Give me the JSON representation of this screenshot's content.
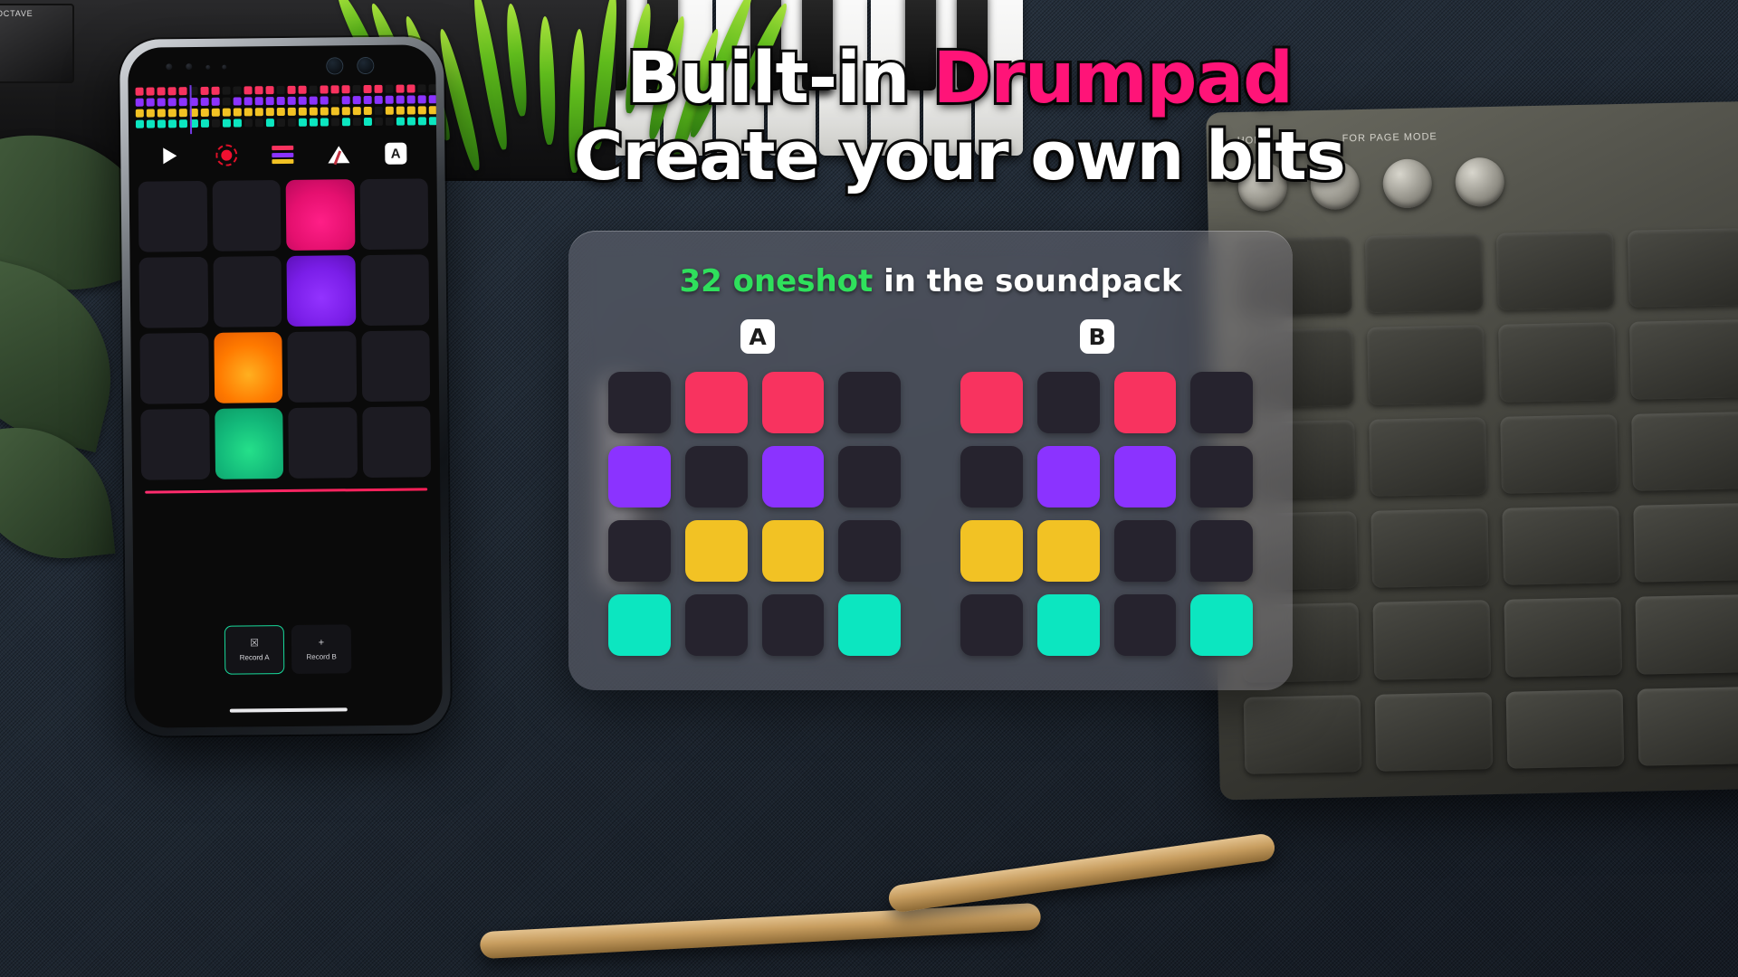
{
  "headline": {
    "line1_prefix": "Built-in ",
    "line1_accent": "Drumpad",
    "line2": "Create your own bits",
    "accent_color": "#ff1478"
  },
  "overlay": {
    "title_count": "32 oneshot",
    "title_rest": " in the soundpack",
    "count_color": "#2fe05c",
    "bank_a_label": "A",
    "bank_b_label": "B",
    "pad_colors": {
      "off": "#26232e",
      "red": "#f8335f",
      "purple": "#8b33ff",
      "yellow": "#f2c224",
      "cyan": "#0ce6c0"
    },
    "bank_a": [
      [
        "off",
        "red",
        "red",
        "off"
      ],
      [
        "purple",
        "off",
        "purple",
        "off"
      ],
      [
        "off",
        "yellow",
        "yellow",
        "off"
      ],
      [
        "cyan",
        "off",
        "off",
        "cyan"
      ]
    ],
    "bank_b": [
      [
        "red",
        "off",
        "red",
        "off"
      ],
      [
        "off",
        "purple",
        "purple",
        "off"
      ],
      [
        "yellow",
        "yellow",
        "off",
        "off"
      ],
      [
        "off",
        "cyan",
        "off",
        "cyan"
      ]
    ]
  },
  "phone": {
    "sequencer": {
      "row_colors": [
        "#f8335f",
        "#8b33ff",
        "#f2c224",
        "#0ce6c0"
      ],
      "off_color": "#171717",
      "steps": 32,
      "playhead_step": 5,
      "rows": [
        [
          1,
          1,
          1,
          1,
          1,
          0,
          1,
          1,
          0,
          0,
          1,
          1,
          1,
          0,
          1,
          1,
          0,
          1,
          1,
          1,
          0,
          1,
          1,
          0,
          1,
          1,
          0,
          0,
          1,
          1,
          0,
          1
        ],
        [
          1,
          1,
          1,
          1,
          1,
          1,
          1,
          1,
          0,
          1,
          1,
          1,
          1,
          1,
          1,
          1,
          1,
          1,
          0,
          1,
          1,
          1,
          1,
          1,
          1,
          1,
          1,
          1,
          1,
          1,
          1,
          1
        ],
        [
          1,
          1,
          1,
          1,
          1,
          1,
          1,
          1,
          1,
          1,
          1,
          1,
          1,
          1,
          1,
          1,
          1,
          1,
          1,
          1,
          1,
          1,
          0,
          1,
          1,
          1,
          1,
          1,
          1,
          1,
          1,
          1
        ],
        [
          1,
          1,
          1,
          1,
          1,
          1,
          1,
          0,
          1,
          1,
          0,
          0,
          1,
          0,
          0,
          1,
          1,
          1,
          0,
          1,
          0,
          1,
          0,
          0,
          1,
          1,
          1,
          1,
          0,
          0,
          0,
          1
        ]
      ]
    },
    "toolbar": [
      {
        "name": "play-icon",
        "label": "play"
      },
      {
        "name": "record-icon",
        "label": "record"
      },
      {
        "name": "mixer-icon",
        "label": "mixer"
      },
      {
        "name": "metronome-icon",
        "label": "metronome"
      },
      {
        "name": "bank-a-icon",
        "label": "A"
      }
    ],
    "mixer_bar_colors": [
      "#f8335f",
      "#8b33ff",
      "#f2c224"
    ],
    "pads": [
      [
        "off",
        "off",
        "pink",
        "off"
      ],
      [
        "off",
        "off",
        "purple",
        "off"
      ],
      [
        "off",
        "orange",
        "off",
        "off"
      ],
      [
        "off",
        "green",
        "off",
        "off"
      ]
    ],
    "record_buttons": [
      {
        "label": "Record A",
        "icon": "trash-icon",
        "glyph": "☒",
        "selected": true
      },
      {
        "label": "Record B",
        "icon": "plus-icon",
        "glyph": "+",
        "selected": false
      }
    ]
  }
}
